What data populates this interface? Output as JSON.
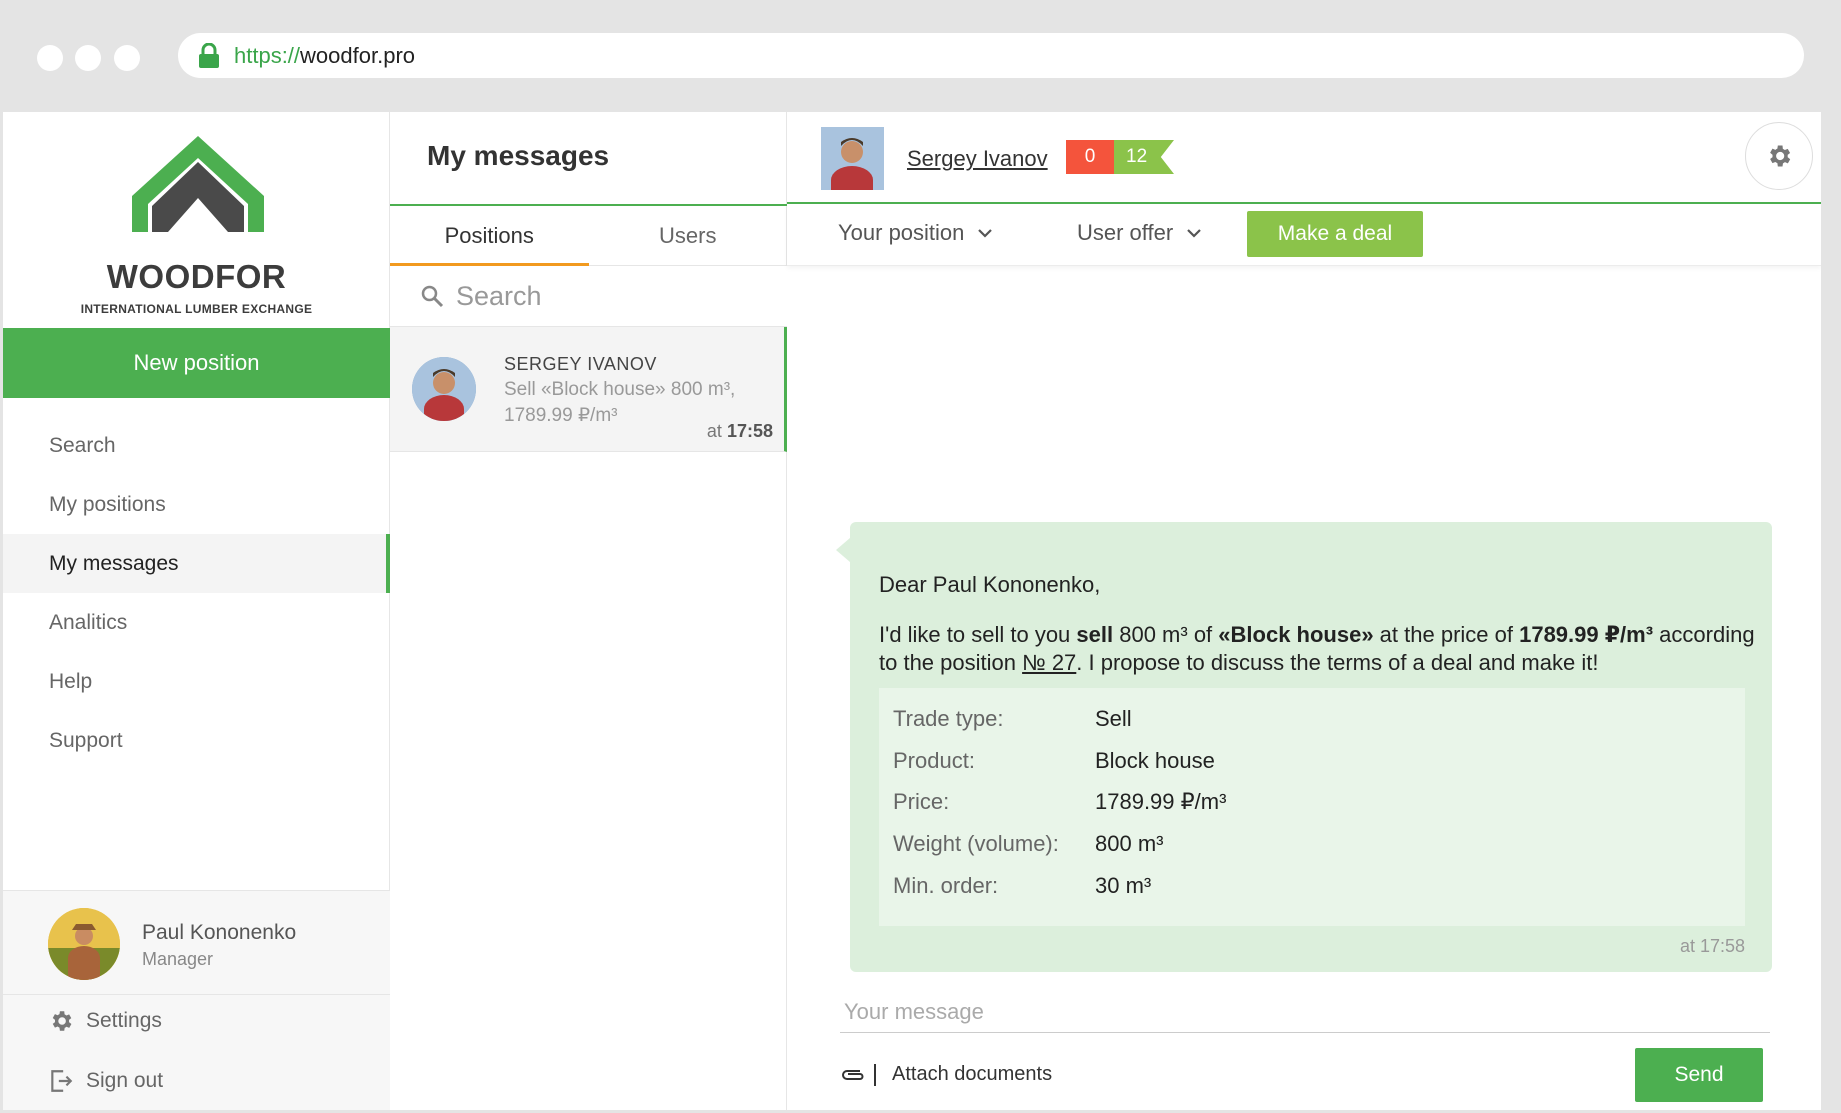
{
  "browser": {
    "url_protocol": "https://",
    "url_host": "woodfor.pro"
  },
  "sidebar": {
    "logo_word": "WOODFOR",
    "logo_subtitle": "INTERNATIONAL LUMBER EXCHANGE",
    "new_position_label": "New position",
    "items": [
      {
        "label": "Search"
      },
      {
        "label": "My positions"
      },
      {
        "label": "My messages",
        "active": true
      },
      {
        "label": "Analitics"
      },
      {
        "label": "Help"
      },
      {
        "label": "Support"
      }
    ],
    "user": {
      "name": "Paul Kononenko",
      "role": "Manager"
    },
    "settings_label": "Settings",
    "signout_label": "Sign out"
  },
  "messages_panel": {
    "title": "My messages",
    "tabs": [
      {
        "label": "Positions",
        "active": true
      },
      {
        "label": "Users"
      }
    ],
    "search_placeholder": "Search",
    "conversations": [
      {
        "name": "SERGEY IVANOV",
        "preview": "Sell «Block house» 800 m³, 1789.99 ₽/m³",
        "time_prefix": "at",
        "time": "17:58"
      }
    ]
  },
  "chat": {
    "contact_name": "Sergey Ivanov",
    "rating_negative": "0",
    "rating_positive": "12",
    "your_position_label": "Your position",
    "user_offer_label": "User offer",
    "make_deal_label": "Make a deal",
    "message": {
      "greeting": "Dear Paul Kononenko,",
      "body": {
        "t1": "I'd like to sell to you ",
        "b1": "sell",
        "t2": " 800 m³ of ",
        "b2": "«Block house»",
        "t3": " at the price of ",
        "b3": "1789.99 ₽/m³",
        "t4": " according to the position ",
        "link": "№ 27",
        "t5": ". I propose to discuss the terms of a deal and make it!"
      },
      "details": [
        {
          "label": "Trade type:",
          "value": "Sell"
        },
        {
          "label": "Product:",
          "value": "Block house"
        },
        {
          "label": "Price:",
          "value": "1789.99 ₽/m³"
        },
        {
          "label": "Weight (volume):",
          "value": "800 m³"
        },
        {
          "label": "Min. order:",
          "value": "30 m³"
        }
      ],
      "time": "at 17:58"
    },
    "input_placeholder": "Your message",
    "attach_label": "Attach documents",
    "send_label": "Send"
  },
  "colors": {
    "brand_green": "#4caf50",
    "light_green": "#8bc34a",
    "accent_orange": "#f29a1f",
    "badge_red": "#f4543c",
    "bubble_bg": "#dcefdc"
  }
}
